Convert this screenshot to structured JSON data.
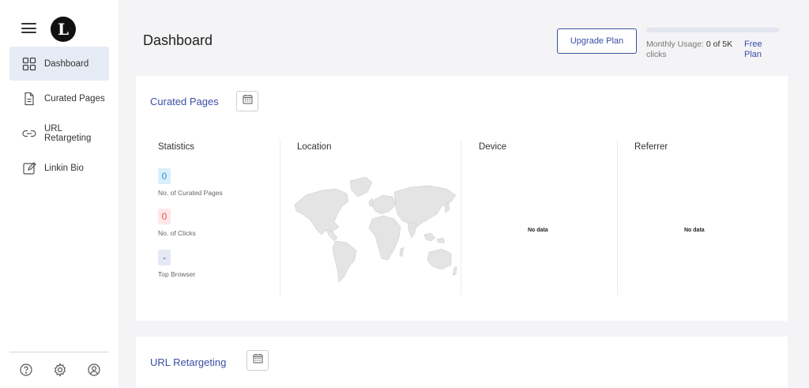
{
  "brand": {
    "logo_letter": "L"
  },
  "sidebar": {
    "items": [
      {
        "label": "Dashboard",
        "icon": "dashboard-grid-icon",
        "active": true
      },
      {
        "label": "Curated Pages",
        "icon": "document-icon",
        "active": false
      },
      {
        "label": "URL Retargeting",
        "icon": "link-icon",
        "active": false
      },
      {
        "label": "Linkin Bio",
        "icon": "edit-square-icon",
        "active": false
      }
    ],
    "footer_icons": [
      "help-icon",
      "settings-gear-icon",
      "user-profile-icon"
    ]
  },
  "header": {
    "title": "Dashboard",
    "upgrade_label": "Upgrade Plan",
    "usage": {
      "label": "Monthly Usage:",
      "value": "0 of 5K",
      "unit": "clicks",
      "plan": "Free Plan",
      "progress": 0
    }
  },
  "curated": {
    "title": "Curated Pages",
    "columns": {
      "statistics": "Statistics",
      "location": "Location",
      "device": "Device",
      "referrer": "Referrer"
    },
    "stats": [
      {
        "value": "0",
        "label": "No. of Curated Pages",
        "color": "#2f9be3"
      },
      {
        "value": "0",
        "label": "No. of Clicks",
        "color": "#ea5455"
      },
      {
        "value": "-",
        "label": "Top Browser",
        "color": "#3a4ea6"
      }
    ],
    "device_empty": "No data",
    "referrer_empty": "No data"
  },
  "retargeting": {
    "title": "URL Retargeting"
  },
  "colors": {
    "accent": "#3a4ea6",
    "active_nav_bg": "#e6ecf6",
    "page_bg": "#f4f4f6"
  }
}
